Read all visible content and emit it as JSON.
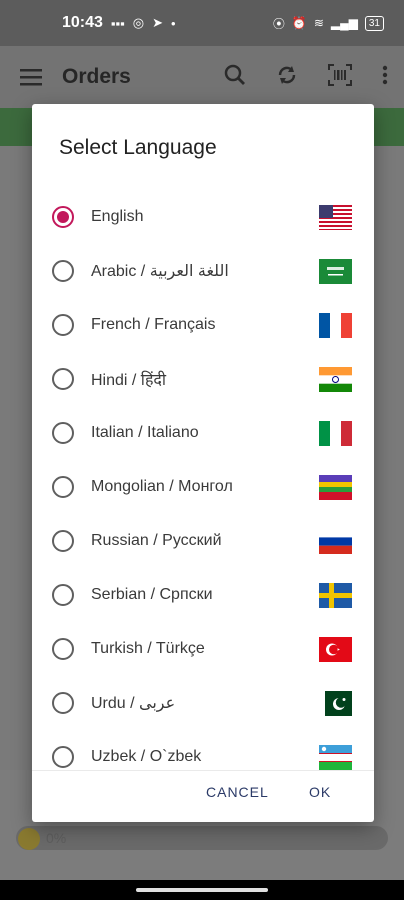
{
  "status_bar": {
    "time": "10:43",
    "battery": "31"
  },
  "app_bar": {
    "title": "Orders"
  },
  "dialog": {
    "title": "Select Language",
    "languages": [
      {
        "label": "English",
        "selected": true,
        "flag": "us-flag"
      },
      {
        "label": "Arabic / اللغة العربية",
        "selected": false,
        "flag": "saudi-flag"
      },
      {
        "label": "French / Français",
        "selected": false,
        "flag": "france-flag"
      },
      {
        "label": "Hindi / हिंदी",
        "selected": false,
        "flag": "india-flag"
      },
      {
        "label": "Italian / Italiano",
        "selected": false,
        "flag": "italy-flag"
      },
      {
        "label": "Mongolian / Монгол",
        "selected": false,
        "flag": "mongolian-flag"
      },
      {
        "label": "Russian / Русский",
        "selected": false,
        "flag": "russia-flag"
      },
      {
        "label": "Serbian / Српски",
        "selected": false,
        "flag": "serbian-flag"
      },
      {
        "label": "Turkish / Türkçe",
        "selected": false,
        "flag": "turkey-flag"
      },
      {
        "label": "Urdu / عربى",
        "selected": false,
        "flag": "pakistan-flag"
      },
      {
        "label": "Uzbek / O`zbek",
        "selected": false,
        "flag": "uzbekistan-flag"
      }
    ],
    "cancel_label": "CANCEL",
    "ok_label": "OK"
  },
  "background": {
    "progress_text": "0%"
  },
  "colors": {
    "accent": "#c2185b",
    "button_text": "#2b3a67",
    "green_bar": "#3c6a3d"
  }
}
